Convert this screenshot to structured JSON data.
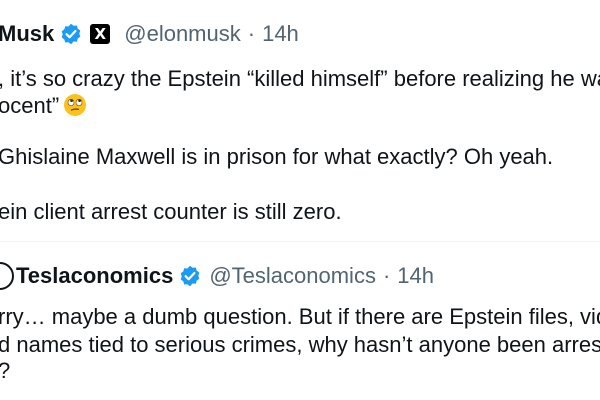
{
  "tweet1": {
    "name": "Musk",
    "handle": "@elonmusk",
    "separator": "·",
    "time": "14h",
    "lines": [
      ", it’s so crazy the Epstein “killed himself” before realizing he wa",
      "ocent”",
      "Ghislaine Maxwell is in prison for what exactly? Oh yeah.",
      "ein client arrest counter is still zero."
    ],
    "emoji": "face-with-rolling-eyes"
  },
  "tweet2": {
    "name": "Teslaconomics",
    "handle": "@Teslaconomics",
    "separator": "·",
    "time": "14h",
    "lines": [
      "rry… maybe a dumb question. But if there are Epstein files, vide",
      "d names tied to serious crimes, why hasn’t anyone been arrest",
      "?"
    ]
  },
  "colors": {
    "verified": "#1d9bf0",
    "text": "#0f1419",
    "muted": "#536471",
    "divider": "#eff3f4"
  }
}
